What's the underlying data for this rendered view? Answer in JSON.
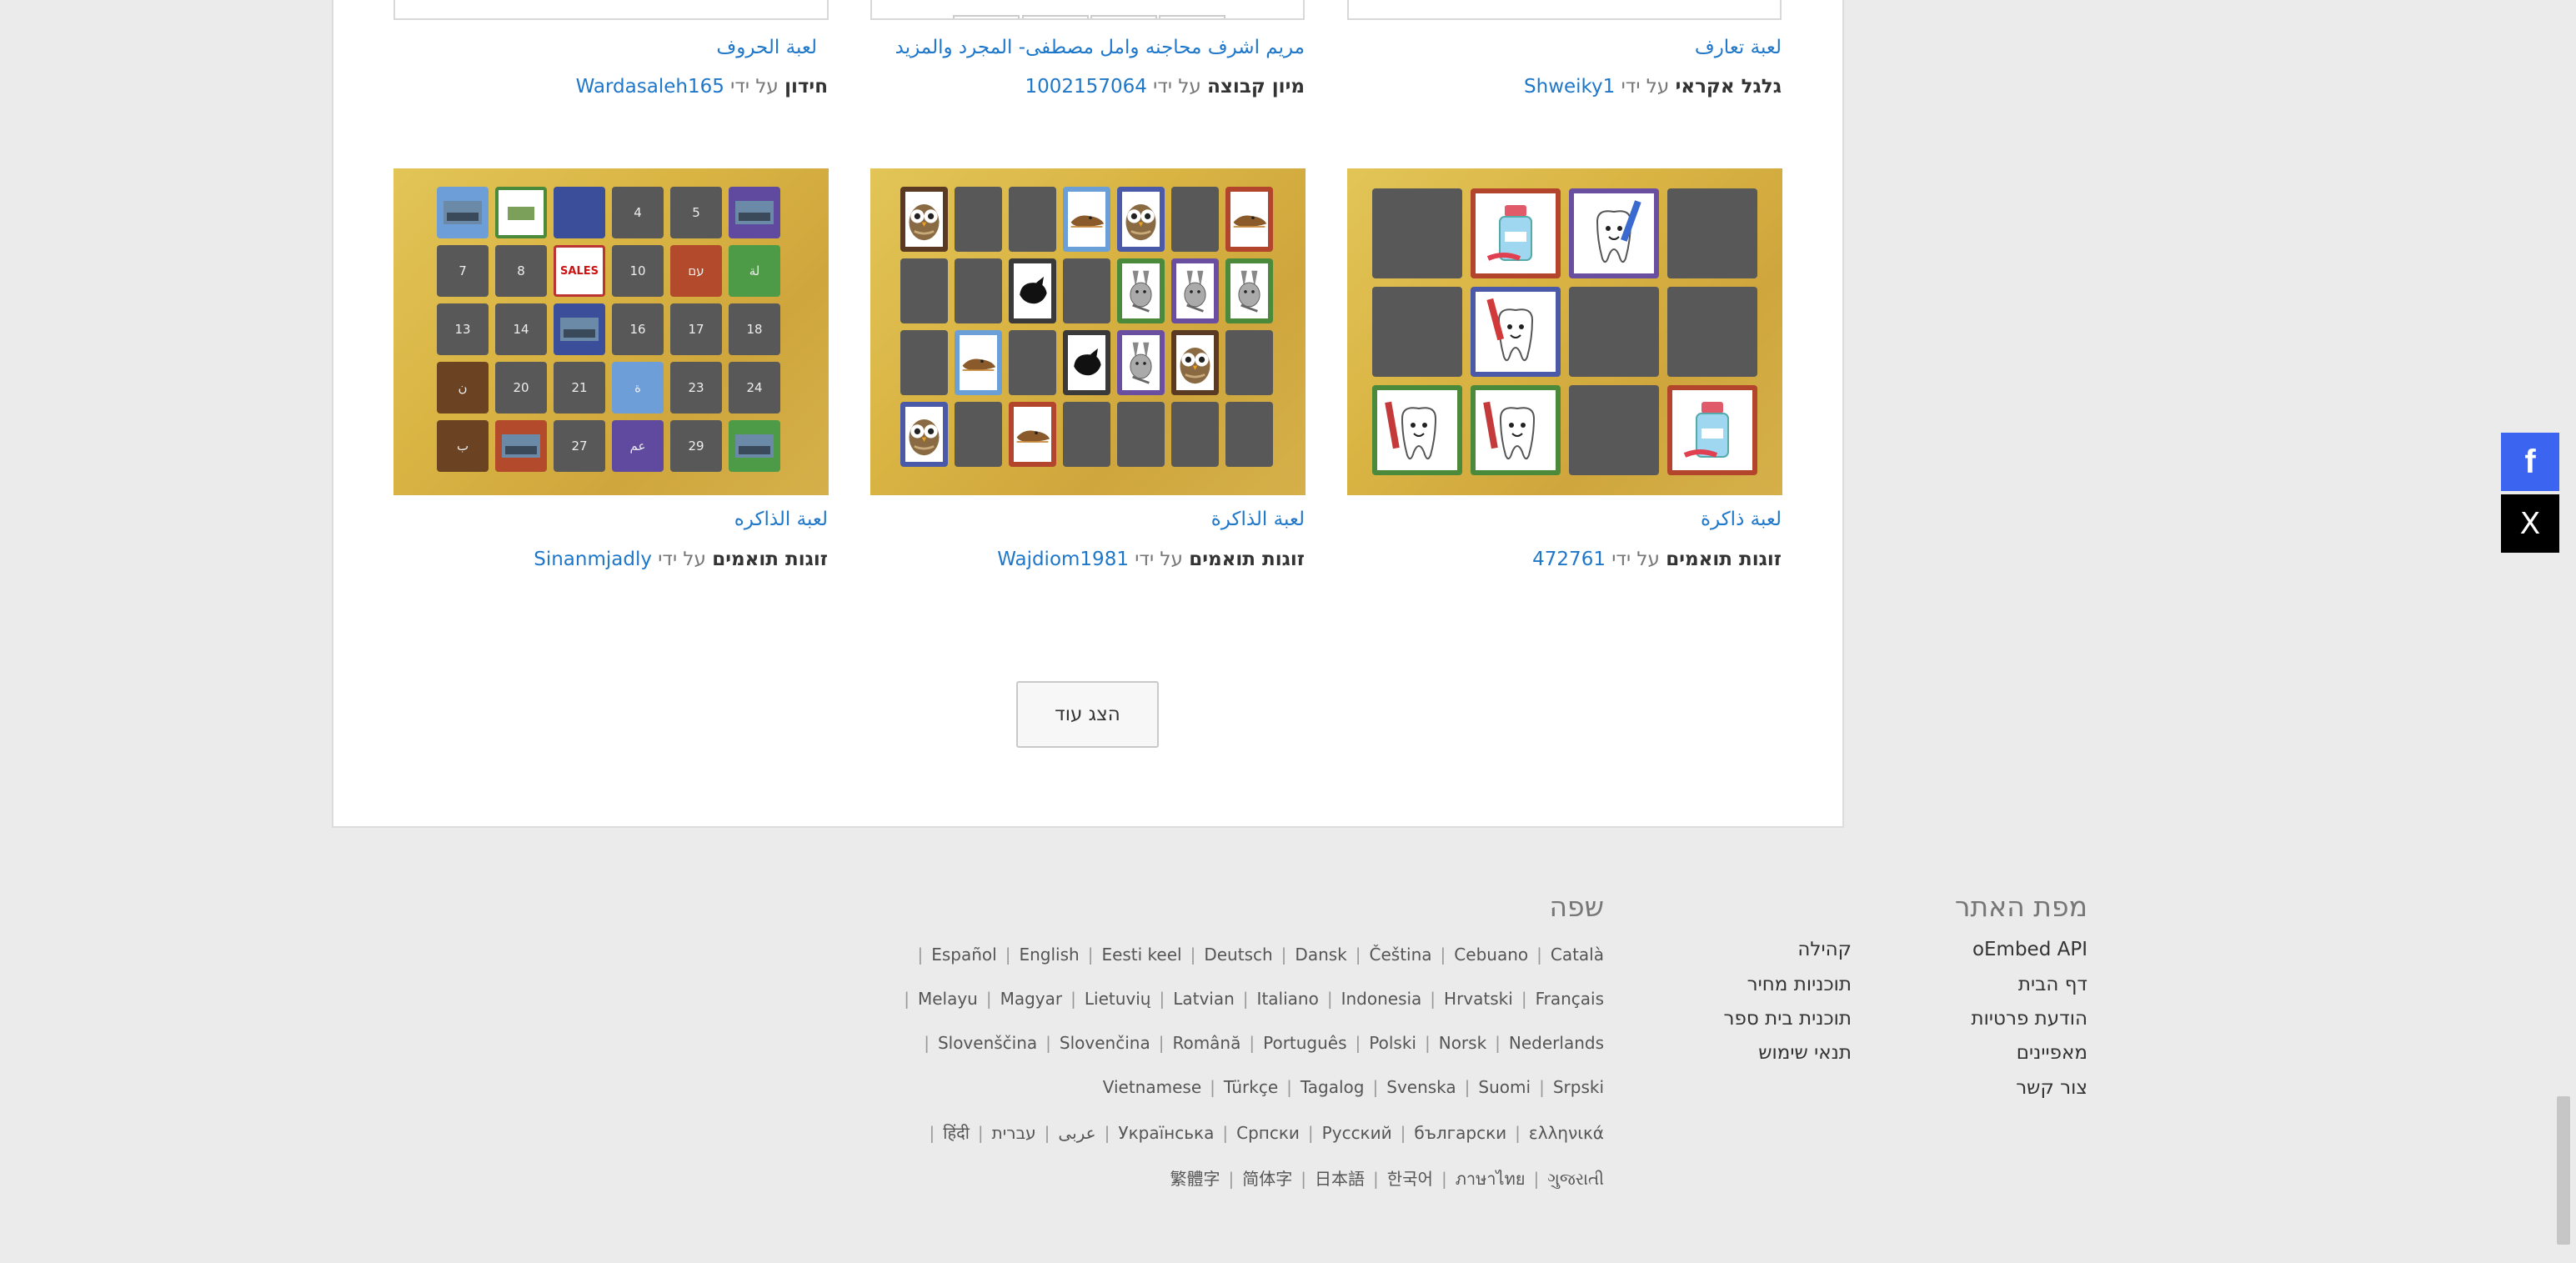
{
  "prev_row": [
    {
      "title": "لعبة تعارف",
      "type": "גלגל אקראי",
      "by": "על ידי",
      "author": "Shweiky1"
    },
    {
      "title": "مريم اشرف محاجنه وامل مصطفى- المجرد والمزيد",
      "type": "מיון קבוצה",
      "by": "על ידי",
      "author": "1002157064"
    },
    {
      "title": "لعبة الحروف",
      "type": "חידון",
      "by": "על ידי",
      "author": "Wardasaleh165"
    }
  ],
  "cards": [
    {
      "title": "لعبة ذاكرة",
      "type": "זוגות תואמים",
      "by": "על ידי",
      "author": "472761"
    },
    {
      "title": "لعبة الذاكرة",
      "type": "זוגות תואמים",
      "by": "על ידי",
      "author": "Wajdiom1981"
    },
    {
      "title": "لعبة الذاكره",
      "type": "זוגות תואמים",
      "by": "על ידי",
      "author": "Sinanmjadly"
    }
  ],
  "number_grid": [
    "",
    "",
    "",
    "4",
    "5",
    "",
    "7",
    "8",
    "SALES",
    "10",
    "עם",
    "لة",
    "13",
    "14",
    "",
    "16",
    "17",
    "18",
    "ن",
    "20",
    "21",
    "ة",
    "23",
    "24",
    "ب",
    "",
    "27",
    "عم",
    "29",
    ""
  ],
  "show_more_label": "הצג עוד",
  "sitemap": {
    "heading": "מפת האתר",
    "col1": [
      "oEmbed API",
      "דף הבית",
      "הודעת פרטיות",
      "מאפיינים",
      "צור קשר"
    ],
    "col2": [
      "קהילה",
      "תוכניות מחיר",
      "תוכנית בית ספר",
      "תנאי שימוש"
    ]
  },
  "language": {
    "heading": "שפה",
    "rows": [
      [
        "Español",
        "English",
        "Eesti keel",
        "Deutsch",
        "Dansk",
        "Čeština",
        "Cebuano",
        "Català"
      ],
      [
        "Melayu",
        "Magyar",
        "Lietuvių",
        "Latvian",
        "Italiano",
        "Indonesia",
        "Hrvatski",
        "Français"
      ],
      [
        "Slovenščina",
        "Slovenčina",
        "Română",
        "Português",
        "Polski",
        "Norsk",
        "Nederlands"
      ],
      [
        "Vietnamese",
        "Türkçe",
        "Tagalog",
        "Svenska",
        "Suomi",
        "Srpski"
      ],
      [
        "हिंदी",
        "عربى",
        "עברית",
        "Українська",
        "Српски",
        "Русский",
        "български",
        "ελληνικά"
      ],
      [
        "繁體字",
        "简体字",
        "日本語",
        "한국어",
        "ภาษาไทย",
        "ગુજરાતી"
      ]
    ]
  },
  "social": {
    "facebook": "f",
    "x": "X",
    "facebook_color": "#3b64f0"
  }
}
